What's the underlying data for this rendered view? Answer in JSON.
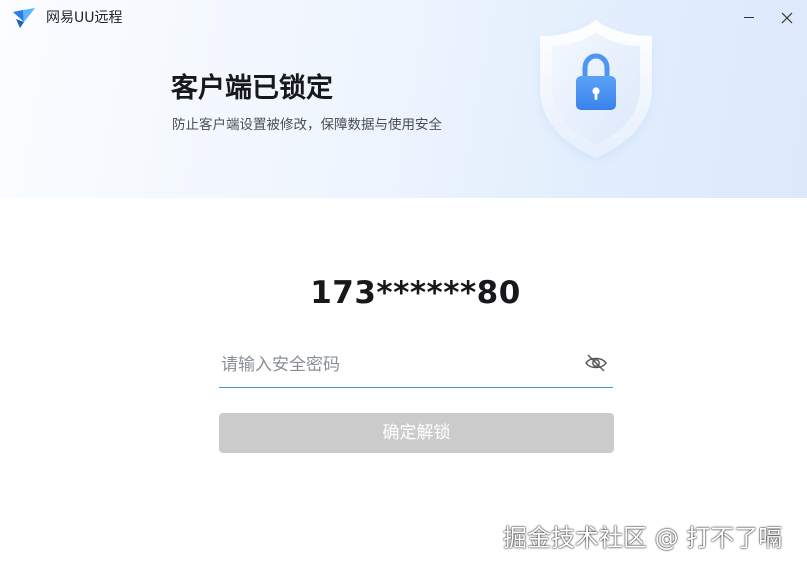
{
  "titlebar": {
    "app_title": "网易UU远程",
    "logo_icon": "uu-remote-logo-icon",
    "minimize_icon": "minimize-icon",
    "close_icon": "close-icon"
  },
  "banner": {
    "title": "客户端已锁定",
    "subtitle": "防止客户端设置被修改，保障数据与使用安全",
    "illustration_icon": "shield-lock-icon"
  },
  "unlock_form": {
    "account": "173******80",
    "password": {
      "value": "",
      "placeholder": "请输入安全密码",
      "visibility_icon": "eye-off-icon"
    },
    "confirm_label": "确定解锁",
    "confirm_enabled": false
  },
  "watermark": "掘金技术社区 @ 打不了嗝",
  "colors": {
    "accent": "#4f8fd6",
    "button_disabled": "#cbcbcb",
    "lock_blue": "#4a90f0"
  }
}
